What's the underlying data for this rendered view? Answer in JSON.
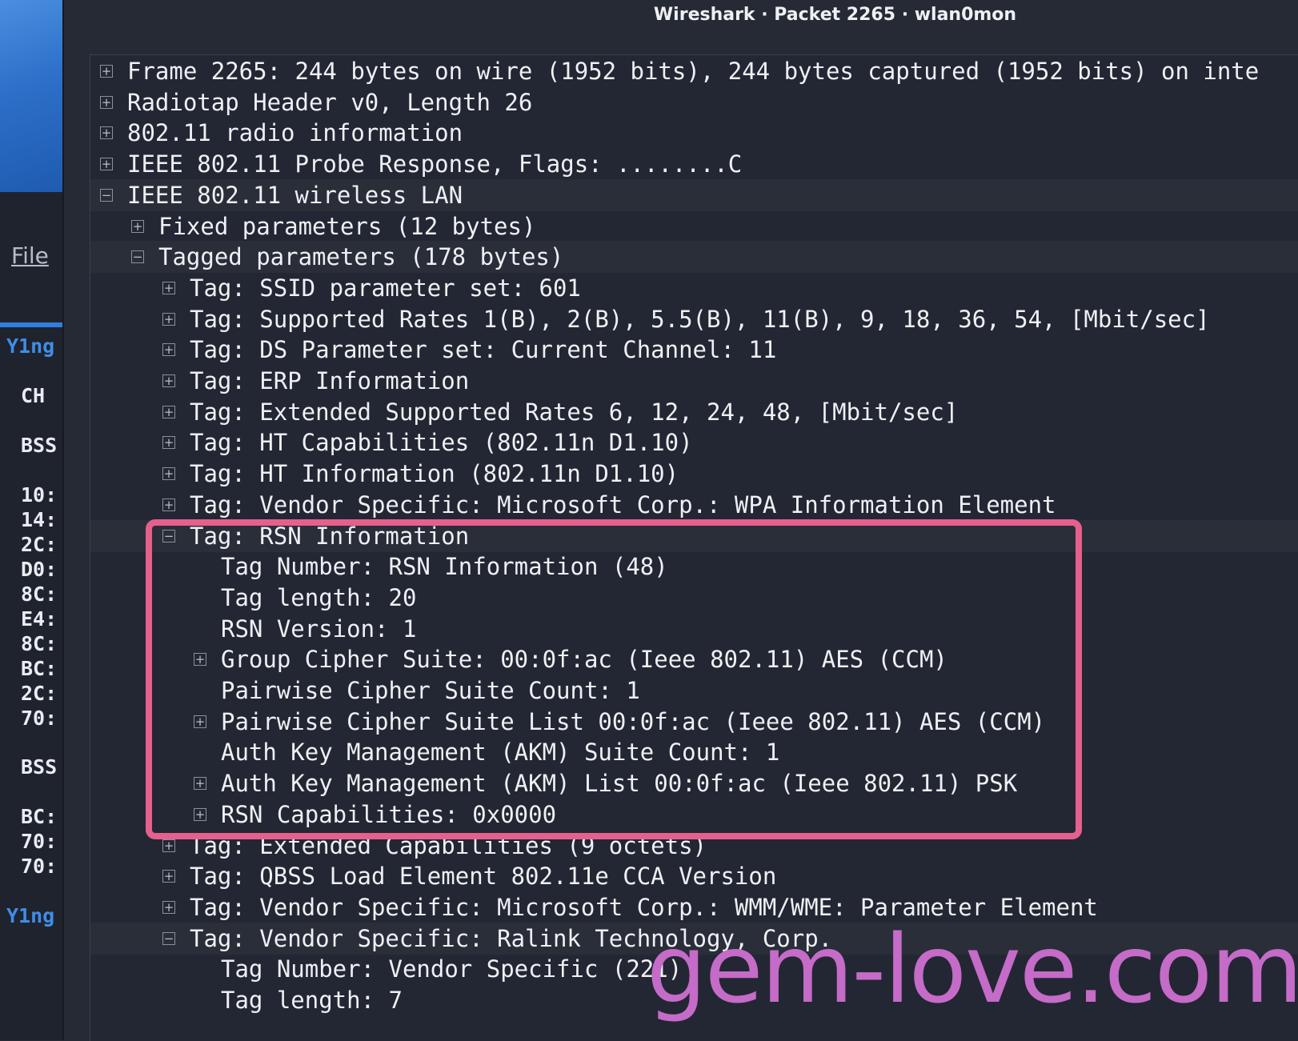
{
  "window": {
    "title": "Wireshark · Packet 2265 · wlan0mon"
  },
  "background": {
    "file_menu": "File",
    "lines": [
      "Y1ng",
      "CH",
      "BSS",
      "10:",
      "14:",
      "2C:",
      "D0:",
      "8C:",
      "E4:",
      "8C:",
      "BC:",
      "2C:",
      "70:",
      "BSS",
      "BC:",
      "70:",
      "70:",
      "Y1ng"
    ]
  },
  "tree": [
    {
      "text": "Frame 2265: 244 bytes on wire (1952 bits), 244 bytes captured (1952 bits) on inte",
      "expander": "+"
    },
    {
      "text": "Radiotap Header v0, Length 26",
      "expander": "+"
    },
    {
      "text": "802.11 radio information",
      "expander": "+"
    },
    {
      "text": "IEEE 802.11 Probe Response, Flags: ........C",
      "expander": "+"
    },
    {
      "text": "IEEE 802.11 wireless LAN",
      "expander": "−"
    },
    {
      "text": "Fixed parameters (12 bytes)",
      "expander": "+"
    },
    {
      "text": "Tagged parameters (178 bytes)",
      "expander": "−"
    },
    {
      "text": "Tag: SSID parameter set: 601",
      "expander": "+"
    },
    {
      "text": "Tag: Supported Rates 1(B), 2(B), 5.5(B), 11(B), 9, 18, 36, 54, [Mbit/sec]",
      "expander": "+"
    },
    {
      "text": "Tag: DS Parameter set: Current Channel: 11",
      "expander": "+"
    },
    {
      "text": "Tag: ERP Information",
      "expander": "+"
    },
    {
      "text": "Tag: Extended Supported Rates 6, 12, 24, 48, [Mbit/sec]",
      "expander": "+"
    },
    {
      "text": "Tag: HT Capabilities (802.11n D1.10)",
      "expander": "+"
    },
    {
      "text": "Tag: HT Information (802.11n D1.10)",
      "expander": "+"
    },
    {
      "text": "Tag: Vendor Specific: Microsoft Corp.: WPA Information Element",
      "expander": "+"
    },
    {
      "text": "Tag: RSN Information",
      "expander": "−"
    },
    {
      "text": "Tag Number: RSN Information (48)",
      "expander": ""
    },
    {
      "text": "Tag length: 20",
      "expander": ""
    },
    {
      "text": "RSN Version: 1",
      "expander": ""
    },
    {
      "text": "Group Cipher Suite: 00:0f:ac (Ieee 802.11) AES (CCM)",
      "expander": "+"
    },
    {
      "text": "Pairwise Cipher Suite Count: 1",
      "expander": ""
    },
    {
      "text": "Pairwise Cipher Suite List 00:0f:ac (Ieee 802.11) AES (CCM)",
      "expander": "+"
    },
    {
      "text": "Auth Key Management (AKM) Suite Count: 1",
      "expander": ""
    },
    {
      "text": "Auth Key Management (AKM) List 00:0f:ac (Ieee 802.11) PSK",
      "expander": "+"
    },
    {
      "text": "RSN Capabilities: 0x0000",
      "expander": "+"
    },
    {
      "text": "Tag: Extended Capabilities (9 octets)",
      "expander": "+"
    },
    {
      "text": "Tag: QBSS Load Element 802.11e CCA Version",
      "expander": "+"
    },
    {
      "text": "Tag: Vendor Specific: Microsoft Corp.: WMM/WME: Parameter Element",
      "expander": "+"
    },
    {
      "text": "Tag: Vendor Specific: Ralink Technology, Corp.",
      "expander": "−"
    },
    {
      "text": "Tag Number: Vendor Specific (221)",
      "expander": ""
    },
    {
      "text": "Tag length: 7",
      "expander": ""
    }
  ],
  "watermark": "gem-love.com",
  "colors": {
    "annotation": "#e5608d",
    "watermark": "#c56bc8",
    "accent": "#3f8de8"
  }
}
